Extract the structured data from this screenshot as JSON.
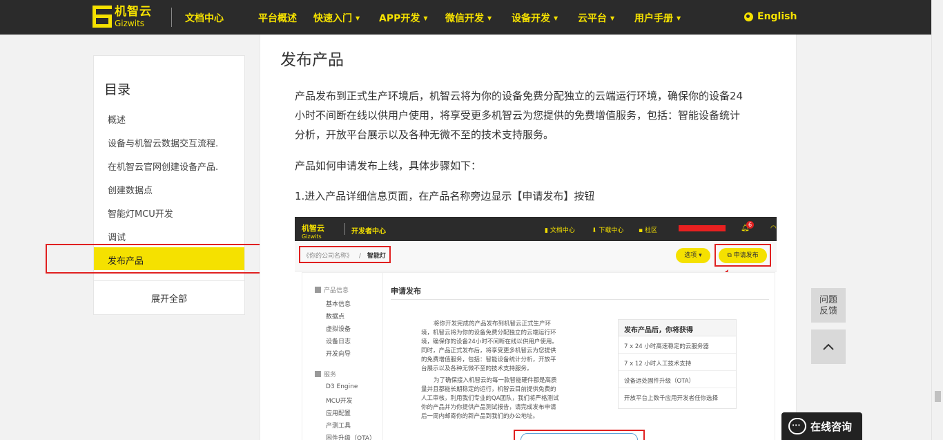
{
  "brand": {
    "cn": "机智云",
    "en": "Gizwits",
    "section": "文档中心"
  },
  "nav": [
    {
      "label": "平台概述",
      "dropdown": false
    },
    {
      "label": "快速入门",
      "dropdown": true
    },
    {
      "label": "APP开发",
      "dropdown": true
    },
    {
      "label": "微信开发",
      "dropdown": true
    },
    {
      "label": "设备开发",
      "dropdown": true
    },
    {
      "label": "云平台",
      "dropdown": true
    },
    {
      "label": "用户手册",
      "dropdown": true
    }
  ],
  "language": "English",
  "toc": {
    "title": "目录",
    "items": [
      "概述",
      "设备与机智云数据交互流程.",
      "在机智云官网创建设备产品.",
      "创建数据点",
      "智能灯MCU开发",
      "调试"
    ],
    "active": "发布产品",
    "expand_all": "展开全部"
  },
  "article": {
    "heading": "发布产品",
    "intro_lines": [
      "产品发布到正式生产环境后，机智云将为你的设备免费分配独立的云端运行环境，确保你的设备24",
      "小时不间断在线以供用户使用，将享受更多机智云为您提供的免费增值服务，包括：智能设备统计",
      "分析，开放平台展示以及各种无微不至的技术支持服务。"
    ],
    "how_to": "产品如何申请发布上线，具体步骤如下：",
    "step1": "1.进入产品详细信息页面，在产品名称旁边显示【申请发布】按钮"
  },
  "screenshot": {
    "logo_cn": "机智云",
    "logo_en": "Gizwits",
    "dev_center": "开发者中心",
    "top_links": [
      "文档中心",
      "下载中心",
      "社区"
    ],
    "notification_count": "6",
    "breadcrumb_company": "《你的公司名称》",
    "breadcrumb_sep": "/",
    "breadcrumb_product": "智能灯",
    "options_button": "选项",
    "apply_button": "申请发布",
    "left_groups": [
      {
        "title": "产品信息",
        "items": [
          "基本信息",
          "数据点",
          "虚拟设备",
          "设备日志",
          "开发向导"
        ]
      },
      {
        "title": "服务",
        "items": [
          "D3 Engine",
          "MCU开发",
          "应用配置",
          "产测工具",
          "固件升级（OTA）"
        ]
      }
    ],
    "panel_title": "申请发布",
    "para1": [
      "将你开发完成的产品发布到机智云正式生产环",
      "境，机智云将为你的设备免费分配独立的云端运行环",
      "境，确保你的设备24小时不间断在线以供用户使用。",
      "同时，产品正式发布后，将享受更多机智云为您提供",
      "的免费增值服务，包括：智能设备统计分析，开放平",
      "台展示以及各种无微不至的技术支持服务。"
    ],
    "para2": [
      "为了确保接入机智云的每一款智能硬件都是高质",
      "量并且都能长期稳定的运行，机智云目前提供免费的",
      "人工审核，利用我们专业的QA团队，我们将严格测试",
      "你的产品并为你提供产品测试报告，请完成发布申请",
      "后一周内邮寄你的新产品到我们的办公地址。"
    ],
    "benefits_title": "发布产品后，你将获得",
    "benefits": [
      "7 x 24 小时高速稳定的云服务器",
      "7 x 12 小时人工技术支持",
      "设备远处固件升级（OTA）",
      "开放平台上数千应用开发者任你选择"
    ]
  },
  "float": {
    "feedback_1": "问题",
    "feedback_2": "反馈",
    "chat": "在线咨询"
  },
  "colors": {
    "accent": "#f5e100",
    "topbar": "#2b2b2b",
    "highlight_border": "#e02020"
  }
}
